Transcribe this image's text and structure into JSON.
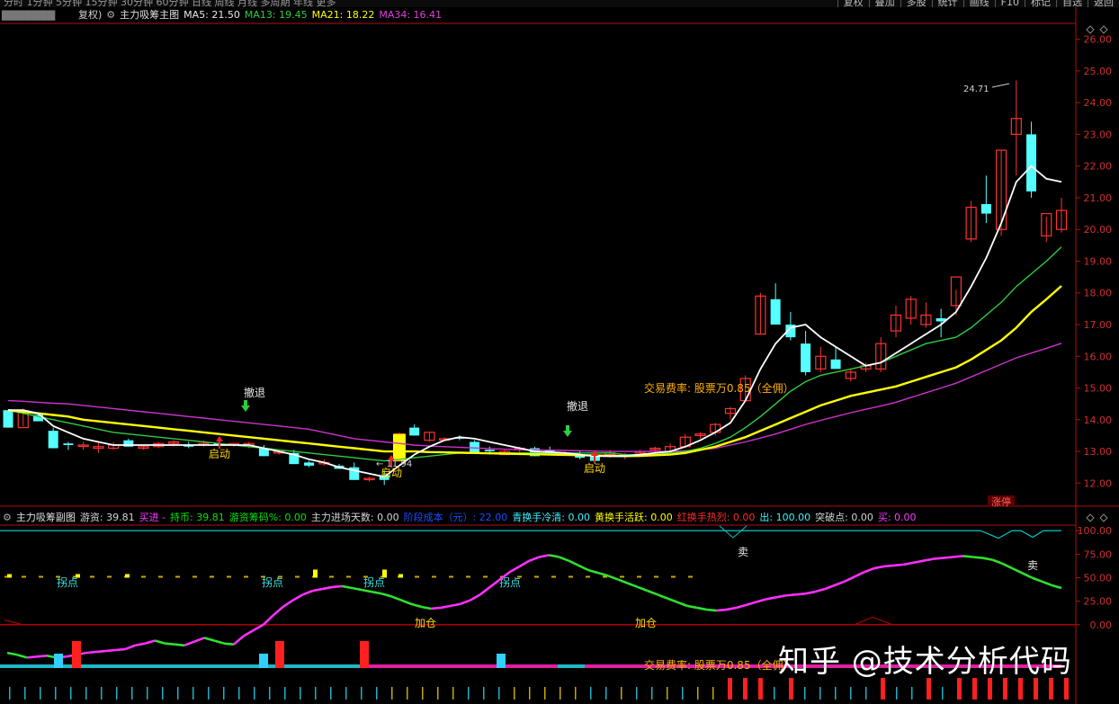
{
  "toolbar": {
    "periods": "分时 1分钟 5分钟 15分钟 30分钟 60分钟 日线 周线 月线 多周期 年线 更多",
    "buttons": [
      "复权",
      "叠加",
      "多股",
      "统计",
      "画线",
      "F10",
      "标记",
      "自选",
      "返回"
    ]
  },
  "main_header": {
    "fq": "复权)",
    "indicator": "主力吸筹主图",
    "ma5_label": "MA5: 21.50",
    "ma13_label": "MA13: 19.45",
    "ma21_label": "MA21: 18.22",
    "ma34_label": "MA34: 16.41"
  },
  "sub_header": {
    "name": "主力吸筹副图",
    "items": [
      {
        "text": "游资: 39.81",
        "color": "#d4d4d4"
      },
      {
        "text": "买进 -",
        "color": "#ff3aff"
      },
      {
        "text": "持币: 39.81",
        "color": "#00e600"
      },
      {
        "text": "游资筹码%: 0.00",
        "color": "#00e600"
      },
      {
        "text": "主力进场天数: 0.00",
        "color": "#d4d4d4"
      },
      {
        "text": "阶段成本（元）: 22.00",
        "color": "#1a4cff"
      },
      {
        "text": "青换手冷清: 0.00",
        "color": "#3ef0ff"
      },
      {
        "text": "黄换手活跃: 0.00",
        "color": "#ffff00"
      },
      {
        "text": "红换手热烈: 0.00",
        "color": "#ff2a2a"
      },
      {
        "text": "出: 100.00",
        "color": "#3ef0ff"
      },
      {
        "text": "突破点: 0.00",
        "color": "#d4d4d4"
      },
      {
        "text": "买: 0.00",
        "color": "#ff3aff"
      }
    ]
  },
  "annotations": {
    "retreat": "撤退",
    "start": "启动",
    "low_label": "11.94",
    "high_label": "24.71",
    "fee_text": "交易费率: 股票万0.85（全佣）",
    "limit_up": "涨停",
    "turn": "拐点",
    "add": "加仓",
    "sell": "卖"
  },
  "watermark": "知乎 @技术分析代码",
  "colors": {
    "up": "#ff3232",
    "down": "#54ffff",
    "ma5": "#ffffff",
    "ma13": "#2ecc40",
    "ma21": "#ffff00",
    "ma34": "#cc33cc",
    "axis": "#b01010"
  },
  "chart_data": [
    {
      "type": "candlestick",
      "title": "主力吸筹主图",
      "ylim": [
        11.3,
        26.5
      ],
      "yticks": [
        12.0,
        13.0,
        14.0,
        15.0,
        16.0,
        17.0,
        18.0,
        19.0,
        20.0,
        21.0,
        22.0,
        23.0,
        24.0,
        25.0,
        26.0
      ],
      "candles": [
        [
          14.3,
          14.3,
          13.75,
          13.75
        ],
        [
          13.75,
          14.35,
          13.8,
          14.25
        ],
        [
          14.15,
          14.2,
          13.95,
          13.95
        ],
        [
          13.65,
          13.75,
          13.1,
          13.1
        ],
        [
          13.25,
          13.3,
          13.05,
          13.2
        ],
        [
          13.2,
          13.3,
          13.05,
          13.2
        ],
        [
          13.1,
          13.3,
          12.95,
          13.15
        ],
        [
          13.1,
          13.3,
          13.05,
          13.2
        ],
        [
          13.35,
          13.4,
          13.15,
          13.15
        ],
        [
          13.1,
          13.2,
          13.05,
          13.15
        ],
        [
          13.15,
          13.3,
          13.1,
          13.25
        ],
        [
          13.25,
          13.35,
          13.15,
          13.3
        ],
        [
          13.2,
          13.3,
          13.1,
          13.15
        ],
        [
          13.25,
          13.35,
          13.15,
          13.25
        ],
        [
          13.25,
          13.3,
          13.15,
          13.2
        ],
        [
          13.2,
          13.25,
          13.15,
          13.25
        ],
        [
          13.2,
          13.3,
          13.1,
          13.25
        ],
        [
          13.1,
          13.2,
          12.85,
          12.85
        ],
        [
          12.95,
          13.05,
          12.9,
          13.0
        ],
        [
          12.95,
          13.05,
          12.6,
          12.6
        ],
        [
          12.65,
          12.7,
          12.5,
          12.55
        ],
        [
          12.65,
          12.75,
          12.55,
          12.65
        ],
        [
          12.55,
          12.6,
          12.45,
          12.45
        ],
        [
          12.5,
          12.65,
          12.1,
          12.1
        ],
        [
          12.15,
          12.2,
          12.05,
          12.15
        ],
        [
          12.25,
          12.4,
          11.94,
          12.1
        ],
        [
          12.7,
          13.6,
          12.7,
          13.55
        ],
        [
          13.75,
          13.85,
          13.5,
          13.5
        ],
        [
          13.35,
          13.6,
          13.3,
          13.6
        ],
        [
          13.4,
          13.45,
          13.35,
          13.4
        ],
        [
          13.45,
          13.5,
          13.35,
          13.4
        ],
        [
          13.3,
          13.35,
          12.95,
          12.95
        ],
        [
          13.05,
          13.15,
          12.95,
          13.0
        ],
        [
          12.9,
          13.05,
          12.9,
          13.0
        ],
        [
          13.05,
          13.15,
          12.9,
          13.1
        ],
        [
          13.1,
          13.15,
          12.85,
          12.85
        ],
        [
          13.05,
          13.15,
          12.95,
          13.0
        ],
        [
          12.95,
          13.0,
          12.9,
          12.95
        ],
        [
          12.9,
          13.0,
          12.75,
          12.8
        ],
        [
          12.85,
          12.9,
          12.6,
          12.7
        ],
        [
          12.9,
          13.05,
          12.8,
          12.95
        ],
        [
          12.85,
          12.95,
          12.75,
          12.9
        ],
        [
          12.95,
          13.05,
          12.85,
          13.0
        ],
        [
          13.05,
          13.15,
          12.95,
          13.1
        ],
        [
          13.0,
          13.25,
          12.95,
          13.15
        ],
        [
          13.15,
          13.55,
          13.1,
          13.45
        ],
        [
          13.5,
          13.6,
          13.4,
          13.55
        ],
        [
          13.6,
          13.9,
          13.5,
          13.85
        ],
        [
          14.2,
          14.4,
          14.0,
          14.35
        ],
        [
          14.6,
          15.4,
          14.6,
          15.3
        ],
        [
          16.7,
          18.0,
          16.7,
          17.9
        ],
        [
          17.8,
          18.3,
          17.4,
          17.0
        ],
        [
          17.0,
          17.4,
          16.5,
          16.6
        ],
        [
          16.4,
          16.8,
          15.4,
          15.5
        ],
        [
          15.6,
          16.3,
          15.5,
          16.0
        ],
        [
          15.9,
          16.3,
          15.7,
          15.6
        ],
        [
          15.3,
          15.6,
          15.2,
          15.5
        ],
        [
          15.6,
          15.8,
          15.5,
          15.7
        ],
        [
          15.6,
          16.6,
          15.5,
          16.4
        ],
        [
          16.8,
          17.6,
          16.6,
          17.3
        ],
        [
          17.2,
          17.9,
          17.0,
          17.8
        ],
        [
          17.0,
          17.7,
          16.9,
          17.3
        ],
        [
          17.2,
          17.5,
          16.6,
          17.1
        ],
        [
          17.6,
          18.1,
          17.3,
          18.5
        ],
        [
          19.7,
          20.9,
          19.6,
          20.7
        ],
        [
          20.8,
          21.7,
          20.2,
          20.5
        ],
        [
          20.0,
          22.5,
          19.8,
          22.5
        ],
        [
          23.0,
          24.7,
          21.7,
          23.5
        ],
        [
          23.0,
          23.4,
          21.0,
          21.2
        ],
        [
          19.8,
          20.4,
          19.6,
          20.5
        ],
        [
          20.0,
          21.0,
          19.9,
          20.6
        ]
      ],
      "ma5": [
        14.3,
        14.3,
        14.2,
        13.8,
        13.6,
        13.4,
        13.3,
        13.2,
        13.2,
        13.2,
        13.2,
        13.2,
        13.2,
        13.2,
        13.2,
        13.2,
        13.2,
        13.1,
        13.0,
        12.9,
        12.75,
        12.65,
        12.5,
        12.4,
        12.3,
        12.2,
        12.55,
        12.9,
        13.15,
        13.35,
        13.45,
        13.4,
        13.3,
        13.2,
        13.1,
        13.0,
        12.98,
        12.95,
        12.9,
        12.85,
        12.85,
        12.85,
        12.9,
        12.95,
        13.0,
        13.15,
        13.35,
        13.6,
        13.9,
        14.6,
        15.6,
        16.4,
        16.9,
        17.0,
        16.6,
        16.3,
        16.0,
        15.7,
        15.8,
        16.1,
        16.4,
        16.7,
        17.0,
        17.4,
        18.2,
        19.1,
        20.2,
        21.5,
        22.0,
        21.6,
        21.5
      ],
      "ma13": [
        14.3,
        14.2,
        14.1,
        14.0,
        13.9,
        13.8,
        13.7,
        13.6,
        13.55,
        13.5,
        13.45,
        13.4,
        13.35,
        13.3,
        13.25,
        13.2,
        13.15,
        13.1,
        13.05,
        13.0,
        12.95,
        12.9,
        12.85,
        12.8,
        12.75,
        12.7,
        12.75,
        12.8,
        12.85,
        12.9,
        12.95,
        12.95,
        12.95,
        12.95,
        12.95,
        12.95,
        12.95,
        12.95,
        12.95,
        12.95,
        12.95,
        12.9,
        12.9,
        12.9,
        12.95,
        13.0,
        13.1,
        13.25,
        13.45,
        13.75,
        14.1,
        14.5,
        14.9,
        15.2,
        15.4,
        15.5,
        15.6,
        15.7,
        15.8,
        16.0,
        16.2,
        16.4,
        16.5,
        16.6,
        16.9,
        17.3,
        17.7,
        18.2,
        18.6,
        19.0,
        19.45
      ],
      "ma21": [
        14.3,
        14.25,
        14.2,
        14.15,
        14.1,
        14.0,
        13.95,
        13.9,
        13.85,
        13.8,
        13.75,
        13.7,
        13.65,
        13.6,
        13.55,
        13.5,
        13.45,
        13.4,
        13.35,
        13.3,
        13.25,
        13.2,
        13.15,
        13.1,
        13.05,
        13.0,
        13.0,
        13.0,
        12.98,
        12.97,
        12.96,
        12.95,
        12.94,
        12.93,
        12.92,
        12.91,
        12.9,
        12.89,
        12.88,
        12.87,
        12.86,
        12.85,
        12.86,
        12.88,
        12.9,
        12.95,
        13.05,
        13.15,
        13.3,
        13.45,
        13.65,
        13.85,
        14.05,
        14.25,
        14.45,
        14.6,
        14.75,
        14.85,
        14.95,
        15.05,
        15.2,
        15.35,
        15.5,
        15.65,
        15.9,
        16.2,
        16.5,
        16.9,
        17.4,
        17.8,
        18.22
      ],
      "ma34": [
        14.6,
        14.58,
        14.55,
        14.52,
        14.5,
        14.45,
        14.4,
        14.35,
        14.3,
        14.25,
        14.2,
        14.15,
        14.1,
        14.05,
        14.0,
        13.95,
        13.9,
        13.85,
        13.8,
        13.75,
        13.7,
        13.6,
        13.5,
        13.4,
        13.35,
        13.3,
        13.25,
        13.2,
        13.17,
        13.15,
        13.13,
        13.11,
        13.09,
        13.07,
        13.06,
        13.05,
        13.04,
        13.03,
        13.02,
        13.01,
        13.0,
        13.0,
        13.0,
        13.0,
        13.0,
        13.02,
        13.05,
        13.1,
        13.2,
        13.3,
        13.42,
        13.55,
        13.7,
        13.85,
        13.98,
        14.1,
        14.22,
        14.33,
        14.43,
        14.55,
        14.7,
        14.85,
        15.0,
        15.15,
        15.35,
        15.55,
        15.75,
        15.95,
        16.1,
        16.25,
        16.41
      ]
    },
    {
      "type": "line",
      "title": "主力吸筹副图",
      "ylim": [
        -5,
        105
      ],
      "yticks": [
        0.0,
        25.0,
        50.0,
        75.0,
        100.0
      ],
      "series": [
        {
          "name": "游资",
          "values": [
            -30,
            -32,
            -35,
            -34,
            -33,
            -35,
            -34,
            -32,
            -30,
            -29,
            -28,
            -27,
            -26,
            -22,
            -20,
            -17,
            -20,
            -21,
            -22,
            -18,
            -14,
            -17,
            -20,
            -21,
            -12,
            -6,
            0,
            10,
            19,
            26,
            32,
            36,
            38,
            40,
            41,
            39,
            37,
            35,
            33,
            30,
            26,
            22,
            19,
            17,
            18,
            20,
            22,
            26,
            32,
            40,
            48,
            56,
            62,
            68,
            72,
            74,
            72,
            68,
            63,
            58,
            55,
            52,
            48,
            44,
            40,
            36,
            32,
            28,
            24,
            20,
            18,
            16,
            15,
            16,
            18,
            21,
            24,
            27,
            29,
            31,
            32,
            33,
            35,
            38,
            42,
            46,
            51,
            56,
            60,
            62,
            63,
            64,
            66,
            68,
            70,
            71,
            72,
            73,
            72,
            71,
            69,
            65,
            60,
            55,
            50,
            46,
            42,
            39
          ]
        }
      ]
    }
  ]
}
